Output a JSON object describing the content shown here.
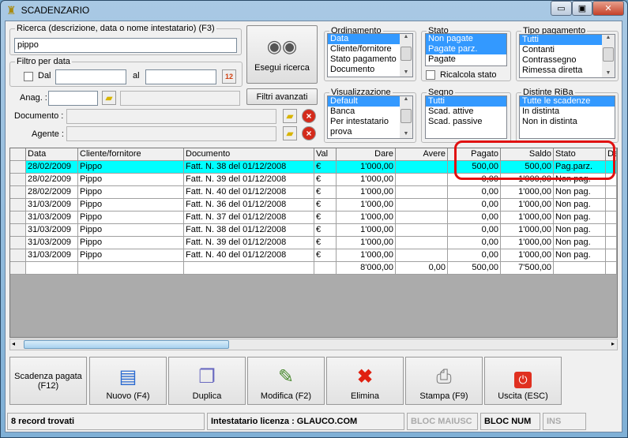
{
  "window": {
    "title": "SCADENZARIO",
    "minimize": "▭",
    "maximize": "▣",
    "close": "✕"
  },
  "search": {
    "legend": "Ricerca (descrizione, data o nome intestatario) (F3)",
    "value": "pippo",
    "button": "Esegui ricerca"
  },
  "date_filter": {
    "legend": "Filtro per data",
    "from_label": "Dal",
    "to_label": "al",
    "from": "",
    "to": ""
  },
  "anag": {
    "label": "Anag. :",
    "advanced": "Filtri avanzati"
  },
  "documento": {
    "label": "Documento :"
  },
  "agente": {
    "label": "Agente :"
  },
  "ordinamento": {
    "legend": "Ordinamento",
    "items": [
      "Data",
      "Cliente/fornitore",
      "Stato pagamento",
      "Documento"
    ],
    "selected": [
      0
    ]
  },
  "stato": {
    "legend": "Stato",
    "items": [
      "Non pagate",
      "Pagate parz.",
      "Pagate"
    ],
    "selected": [
      0,
      1
    ],
    "ricalcola": "Ricalcola stato"
  },
  "tipo_pagamento": {
    "legend": "Tipo pagamento",
    "items": [
      "Tutti",
      "Contanti",
      "Contrassegno",
      "Rimessa diretta"
    ],
    "selected": [
      0
    ]
  },
  "visualizzazione": {
    "legend": "Visualizzazione",
    "items": [
      "Default",
      "Banca",
      "Per intestatario",
      "prova"
    ],
    "selected": [
      0
    ]
  },
  "segno": {
    "legend": "Segno",
    "items": [
      "Tutti",
      "Scad. attive",
      "Scad. passive"
    ],
    "selected": [
      0
    ]
  },
  "distinte": {
    "legend": "Distinte RiBa",
    "items": [
      "Tutte le scadenze",
      "In distinta",
      "Non in distinta"
    ],
    "selected": [
      0
    ]
  },
  "grid": {
    "columns": [
      "Data",
      "Cliente/fornitore",
      "Documento",
      "Val",
      "Dare",
      "Avere",
      "Pagato",
      "Saldo",
      "Stato",
      "De"
    ],
    "rows": [
      [
        "28/02/2009",
        "Pippo",
        "Fatt. N. 38 del 01/12/2008",
        "€",
        "1'000,00",
        "",
        "500,00",
        "500,00",
        "Pag.parz.",
        ""
      ],
      [
        "28/02/2009",
        "Pippo",
        "Fatt. N. 39 del 01/12/2008",
        "€",
        "1'000,00",
        "",
        "0,00",
        "1'000,00",
        "Non pag.",
        ""
      ],
      [
        "28/02/2009",
        "Pippo",
        "Fatt. N. 40 del 01/12/2008",
        "€",
        "1'000,00",
        "",
        "0,00",
        "1'000,00",
        "Non pag.",
        ""
      ],
      [
        "31/03/2009",
        "Pippo",
        "Fatt. N. 36 del 01/12/2008",
        "€",
        "1'000,00",
        "",
        "0,00",
        "1'000,00",
        "Non pag.",
        ""
      ],
      [
        "31/03/2009",
        "Pippo",
        "Fatt. N. 37 del 01/12/2008",
        "€",
        "1'000,00",
        "",
        "0,00",
        "1'000,00",
        "Non pag.",
        ""
      ],
      [
        "31/03/2009",
        "Pippo",
        "Fatt. N. 38 del 01/12/2008",
        "€",
        "1'000,00",
        "",
        "0,00",
        "1'000,00",
        "Non pag.",
        ""
      ],
      [
        "31/03/2009",
        "Pippo",
        "Fatt. N. 39 del 01/12/2008",
        "€",
        "1'000,00",
        "",
        "0,00",
        "1'000,00",
        "Non pag.",
        ""
      ],
      [
        "31/03/2009",
        "Pippo",
        "Fatt. N. 40 del 01/12/2008",
        "€",
        "1'000,00",
        "",
        "0,00",
        "1'000,00",
        "Non pag.",
        ""
      ],
      [
        "",
        "",
        "",
        "",
        "8'000,00",
        "0,00",
        "500,00",
        "7'500,00",
        "",
        ""
      ]
    ],
    "highlight_color": "#00ffff",
    "annotation_color": "#e01010"
  },
  "toolbar": {
    "scadenza": "Scadenza pagata (F12)",
    "nuovo": "Nuovo (F4)",
    "duplica": "Duplica",
    "modifica": "Modifica (F2)",
    "elimina": "Elimina",
    "stampa": "Stampa (F9)",
    "uscita": "Uscita (ESC)"
  },
  "status": {
    "records": "8 record trovati",
    "license": "Intestatario licenza : GLAUCO.COM",
    "caps": "BLOC MAIUSC",
    "num": "BLOC NUM",
    "ins": "INS"
  }
}
